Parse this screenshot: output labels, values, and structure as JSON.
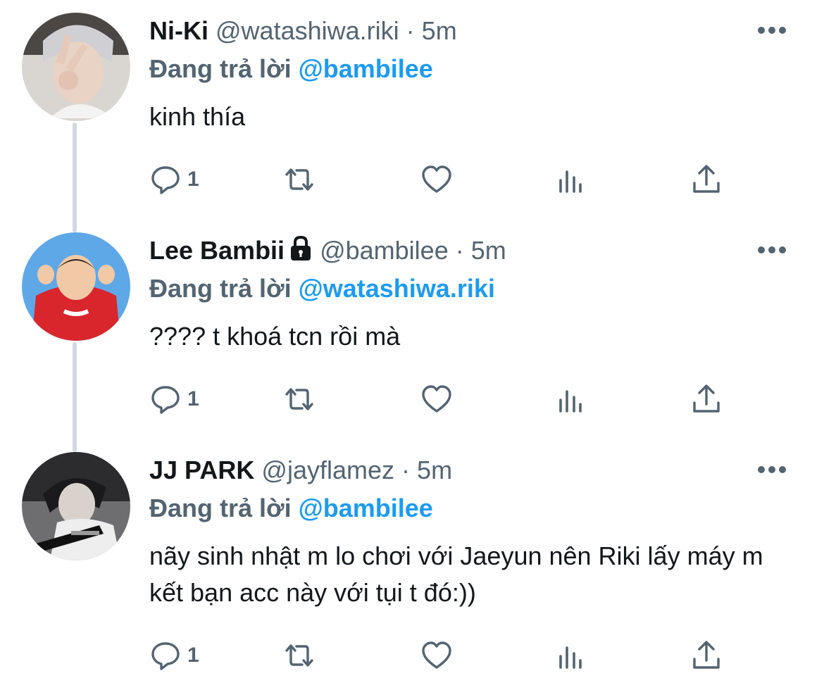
{
  "tweets": [
    {
      "name": "Ni-Ki",
      "handle": "@watashiwa.riki",
      "dot": "·",
      "time": "5m",
      "reply_label": "Đang trả lời",
      "reply_to": "@bambilee",
      "text": "kinh thía",
      "reply_count": "1",
      "locked": false
    },
    {
      "name": "Lee Bambii",
      "handle": "@bambilee",
      "dot": "·",
      "time": "5m",
      "reply_label": "Đang trả lời",
      "reply_to": "@watashiwa.riki",
      "text": "???? t khoá tcn rồi mà",
      "reply_count": "1",
      "locked": true
    },
    {
      "name": "JJ PARK",
      "handle": "@jayflamez",
      "dot": "·",
      "time": "5m",
      "reply_label": "Đang trả lời",
      "reply_to": "@bambilee",
      "text": "nãy sinh nhật m lo chơi với Jaeyun nên Riki lấy máy m kết bạn acc này với tụi t đó:))",
      "reply_count": "1",
      "locked": false
    }
  ],
  "icons": {
    "reply": "reply-icon",
    "retweet": "retweet-icon",
    "like": "heart-icon",
    "views": "views-icon",
    "share": "share-icon",
    "more": "more-icon",
    "lock": "lock-icon"
  },
  "colors": {
    "text": "#14171a",
    "secondary": "#536471",
    "accent": "#1d9bf0",
    "thread_line": "#cfd9de"
  }
}
